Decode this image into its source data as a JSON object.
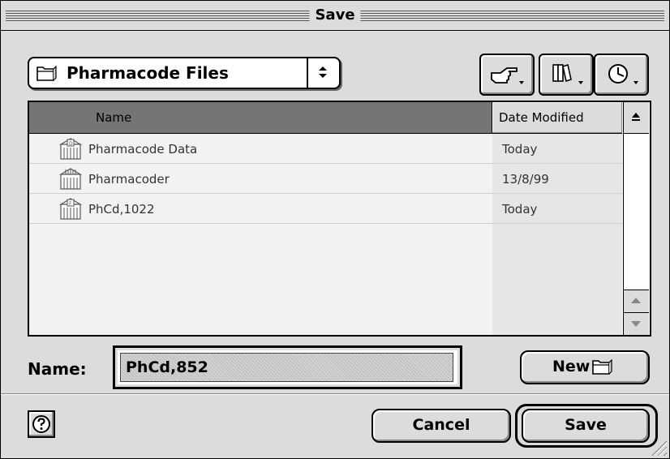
{
  "window": {
    "title": "Save"
  },
  "location_popup": {
    "selected": "Pharmacode Files",
    "icon": "folder-icon"
  },
  "toolbar": {
    "buttons": [
      {
        "icon": "shortcuts-hand-icon"
      },
      {
        "icon": "favorites-books-icon"
      },
      {
        "icon": "recent-clock-icon"
      }
    ]
  },
  "file_list": {
    "columns": {
      "name": "Name",
      "date": "Date Modified"
    },
    "rows": [
      {
        "name": "Pharmacode Data",
        "date": "Today",
        "icon": "data-file-icon"
      },
      {
        "name": "Pharmacoder",
        "date": "13/8/99",
        "icon": "application-file-icon"
      },
      {
        "name": "PhCd,1022",
        "date": "Today",
        "icon": "document-file-icon"
      }
    ]
  },
  "name_field": {
    "label": "Name:",
    "value": "PhCd,852"
  },
  "buttons": {
    "new": "New",
    "cancel": "Cancel",
    "save": "Save"
  },
  "colors": {
    "background": "#dcdcdc",
    "header_selected": "#757575",
    "list_bg": "#f2f2f2"
  }
}
